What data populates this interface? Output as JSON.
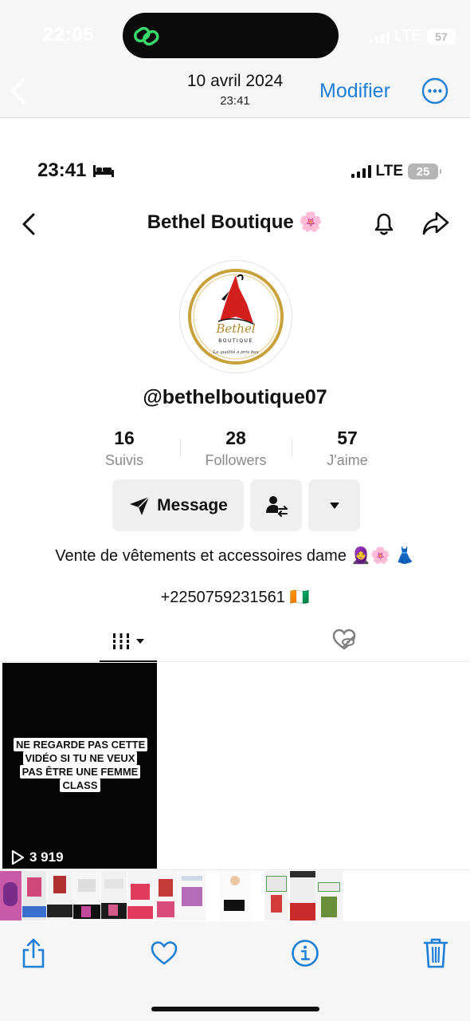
{
  "outer": {
    "time": "22:05",
    "network": "LTE",
    "battery": "57",
    "date": "10 avril 2024",
    "subtime": "23:41",
    "edit_label": "Modifier"
  },
  "inner": {
    "time": "23:41",
    "network": "LTE",
    "battery": "25"
  },
  "profile": {
    "title": "Bethel Boutique 🌸",
    "handle": "@bethelboutique07",
    "logo_text": "Bethel",
    "logo_sub": "BOUTIQUE",
    "logo_tagline": "La qualité à prix bas",
    "stats": [
      {
        "value": "16",
        "label": "Suivis"
      },
      {
        "value": "28",
        "label": "Followers"
      },
      {
        "value": "57",
        "label": "J'aime"
      }
    ],
    "message_label": "Message",
    "bio": "Vente de vêtements et accessoires dame 🧕🌸 👗",
    "phone": "+2250759231561 🇨🇮"
  },
  "videos": [
    {
      "caption": "NE REGARDE PAS CETTE VIDÉO SI TU NE VEUX PAS ÊTRE UNE FEMME CLASS",
      "views": "3 919"
    }
  ],
  "colors": {
    "accent": "#1e7fd6",
    "gold": "#c9a13a",
    "red": "#d41f1f"
  }
}
